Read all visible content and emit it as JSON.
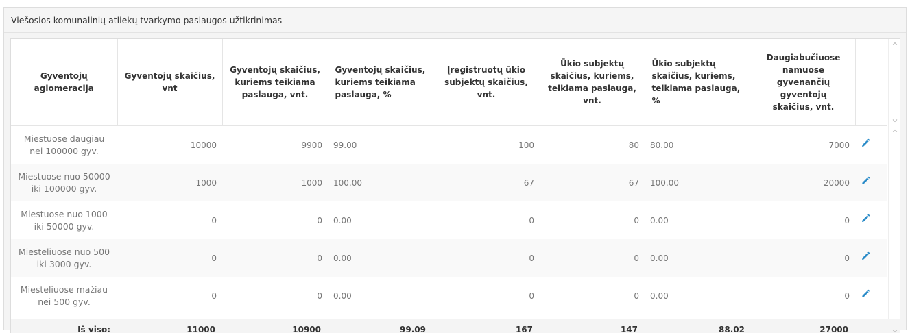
{
  "panel": {
    "title": "Viešosios komunalinių atliekų tvarkymo paslaugos užtikrinimas"
  },
  "table": {
    "headers": [
      "Gyventojų aglomeracija",
      "Gyventojų skaičius, vnt",
      "Gyventojų skaičius, kuriems teikiama paslauga, vnt.",
      "Gyventojų skaičius, kuriems teikiama paslauga, %",
      "Įregistruotų ūkio subjektų skaičius, vnt.",
      "Ūkio subjektų skaičius, kuriems, teikiama paslauga, vnt.",
      "Ūkio subjektų skaičius, kuriems, teikiama paslauga, %",
      "Daugiabučiuose namuose gyvenančių gyventojų skaičius, vnt."
    ],
    "rows": [
      {
        "agglomeration": "Miestuose daugiau nei 100000 gyv.",
        "population": "10000",
        "served_count": "9900",
        "served_pct": "99.00",
        "registered_entities": "100",
        "entities_served": "80",
        "entities_served_pct": "80.00",
        "apartment_residents": "7000"
      },
      {
        "agglomeration": "Miestuose nuo 50000 iki 100000 gyv.",
        "population": "1000",
        "served_count": "1000",
        "served_pct": "100.00",
        "registered_entities": "67",
        "entities_served": "67",
        "entities_served_pct": "100.00",
        "apartment_residents": "20000"
      },
      {
        "agglomeration": "Miestuose nuo 1000 iki 50000 gyv.",
        "population": "0",
        "served_count": "0",
        "served_pct": "0.00",
        "registered_entities": "0",
        "entities_served": "0",
        "entities_served_pct": "0.00",
        "apartment_residents": "0"
      },
      {
        "agglomeration": "Miesteliuose nuo 500 iki 3000 gyv.",
        "population": "0",
        "served_count": "0",
        "served_pct": "0.00",
        "registered_entities": "0",
        "entities_served": "0",
        "entities_served_pct": "0.00",
        "apartment_residents": "0"
      },
      {
        "agglomeration": "Miesteliuose mažiau nei 500 gyv.",
        "population": "0",
        "served_count": "0",
        "served_pct": "0.00",
        "registered_entities": "0",
        "entities_served": "0",
        "entities_served_pct": "0.00",
        "apartment_residents": "0"
      }
    ],
    "totals": {
      "label": "Iš viso:",
      "population": "11000",
      "served_count": "10900",
      "served_pct": "99.09",
      "registered_entities": "167",
      "entities_served": "147",
      "entities_served_pct": "88.02",
      "apartment_residents": "27000"
    }
  },
  "icons": {
    "edit": "pencil-icon",
    "scroll_up": "chevron-up-icon",
    "scroll_down": "chevron-down-icon"
  },
  "colors": {
    "edit_icon": "#2a8bc8",
    "panel_bg": "#f4f4f4",
    "stripe_bg": "#f9f9f9"
  }
}
